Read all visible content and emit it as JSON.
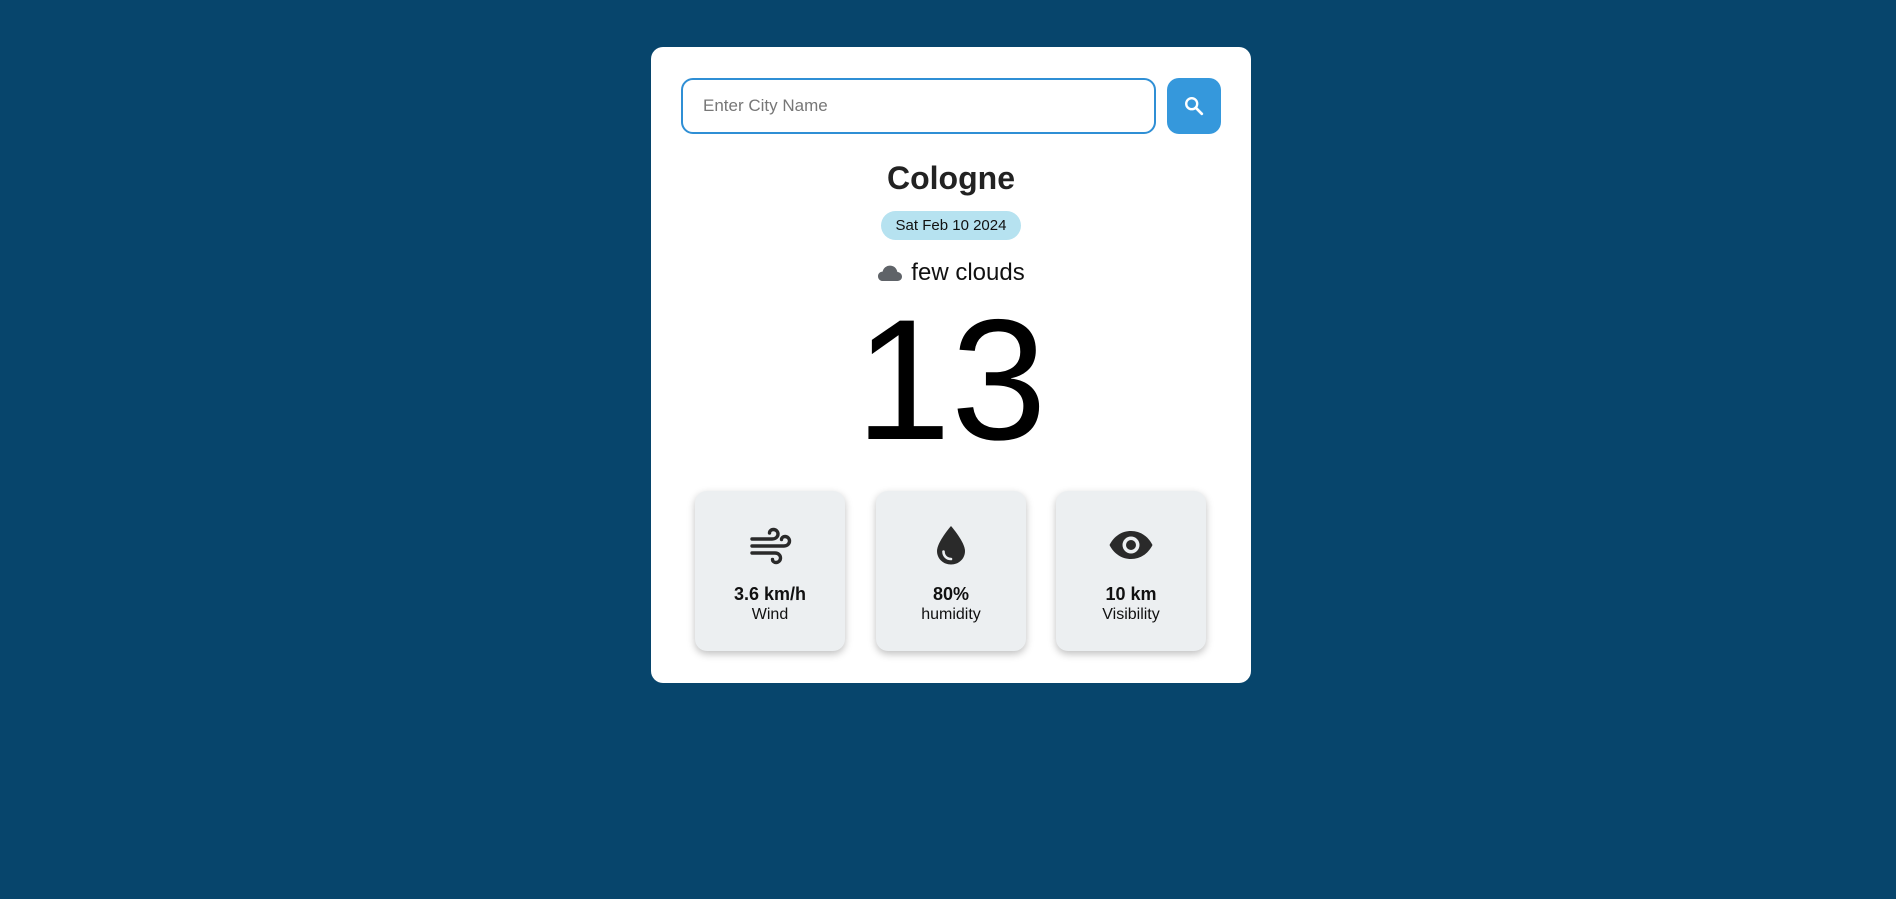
{
  "search": {
    "placeholder": "Enter City Name",
    "value": "",
    "button_icon": "search-icon"
  },
  "location": {
    "city": "Cologne",
    "date": "Sat Feb 10 2024"
  },
  "weather": {
    "condition_icon": "cloud-icon",
    "condition": "few clouds",
    "temperature": "13"
  },
  "stats": [
    {
      "icon": "wind-icon",
      "value": "3.6 km/h",
      "label": "Wind"
    },
    {
      "icon": "water-drop-icon",
      "value": "80%",
      "label": "humidity"
    },
    {
      "icon": "eye-icon",
      "value": "10 km",
      "label": "Visibility"
    }
  ],
  "colors": {
    "background": "#07456c",
    "card": "#ffffff",
    "accent": "#3598dc",
    "date_badge": "#b6e2f0",
    "stat_card": "#eceff1"
  }
}
